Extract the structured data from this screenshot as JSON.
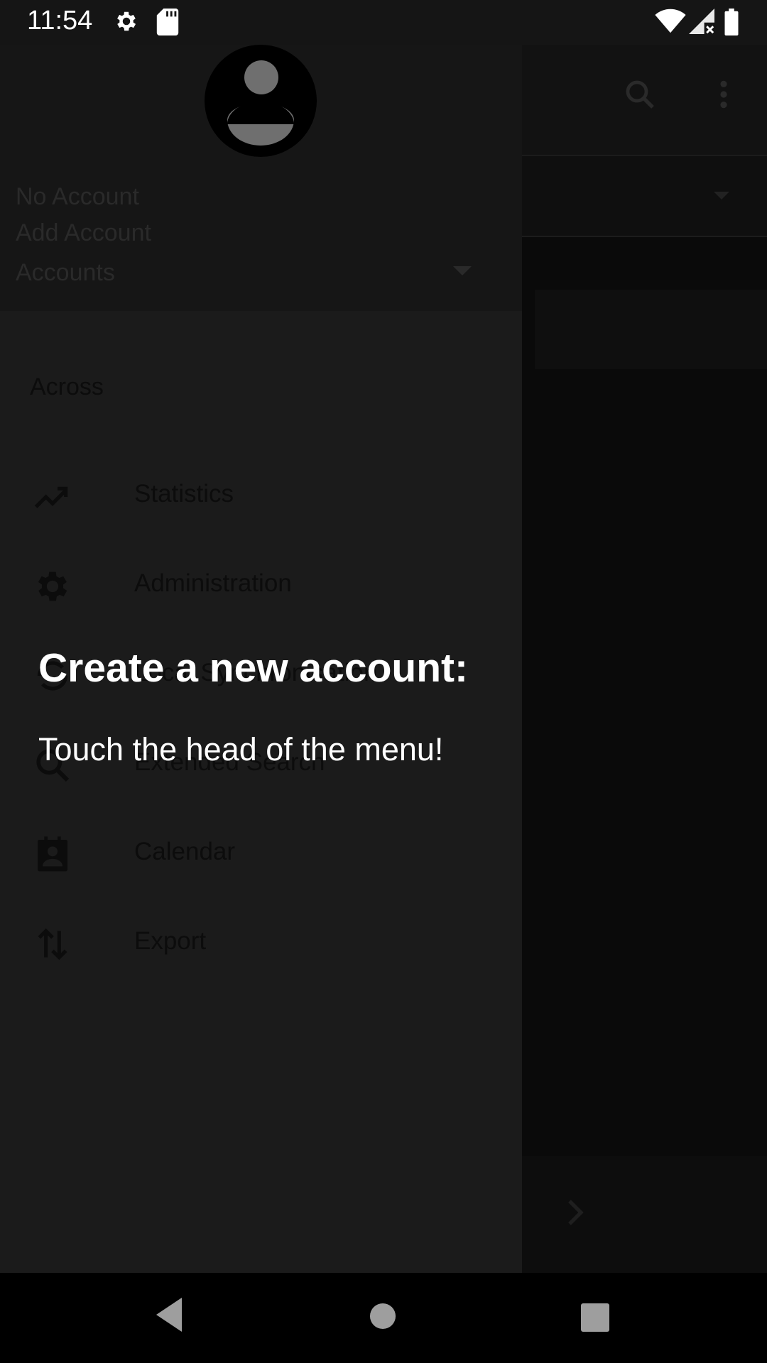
{
  "status_bar": {
    "time": "11:54",
    "icons": [
      "gear-icon",
      "sd-card-icon",
      "wifi-icon",
      "signal-icon",
      "battery-icon"
    ]
  },
  "drawer": {
    "header": {
      "account_name": "No Account",
      "add_account": "Add Account",
      "accounts_label": "Accounts"
    },
    "section_label": "Across",
    "items": [
      {
        "label": "Statistics",
        "icon": "trending-icon"
      },
      {
        "label": "Administration",
        "icon": "gear-icon"
      },
      {
        "label": "Local Synchronisation",
        "icon": "sync-icon"
      },
      {
        "label": "Extended Search",
        "icon": "search-icon"
      },
      {
        "label": "Calendar",
        "icon": "contact-calendar-icon"
      },
      {
        "label": "Export",
        "icon": "swap-vertical-icon"
      }
    ]
  },
  "tutorial": {
    "title": "Create a new account:",
    "body": "Touch the head of the menu!"
  },
  "navigation": {
    "buttons": [
      "back-icon",
      "home-icon",
      "recents-icon"
    ]
  },
  "colors": {
    "drawer_bg": "#1b1b1b",
    "header_bg": "#161616",
    "tip_text": "#ffffff"
  }
}
